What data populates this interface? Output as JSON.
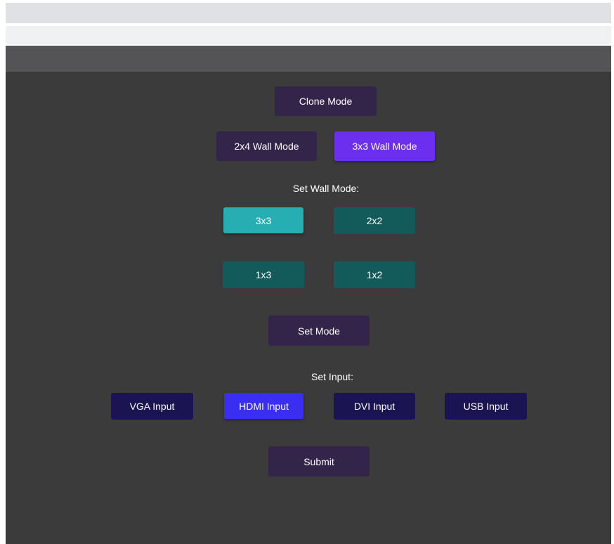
{
  "mode_buttons": {
    "clone": "Clone Mode",
    "wall_2x4": "2x4 Wall Mode",
    "wall_3x3": "3x3 Wall Mode"
  },
  "wall_mode": {
    "label": "Set Wall Mode:",
    "options": [
      "3x3",
      "2x2",
      "1x3",
      "1x2"
    ],
    "selected": "3x3",
    "set_button": "Set Mode"
  },
  "input": {
    "label": "Set Input:",
    "options": [
      "VGA Input",
      "HDMI Input",
      "DVI Input",
      "USB Input"
    ],
    "selected": "HDMI Input",
    "submit_button": "Submit"
  },
  "colors": {
    "panel_bg": "#3b3b3b",
    "mode_button": "#33244a",
    "mode_active": "#6c2eef",
    "wall_button": "#135b5a",
    "wall_active": "#27aeb2",
    "input_button": "#1b1452",
    "input_active": "#3a2ef2"
  }
}
